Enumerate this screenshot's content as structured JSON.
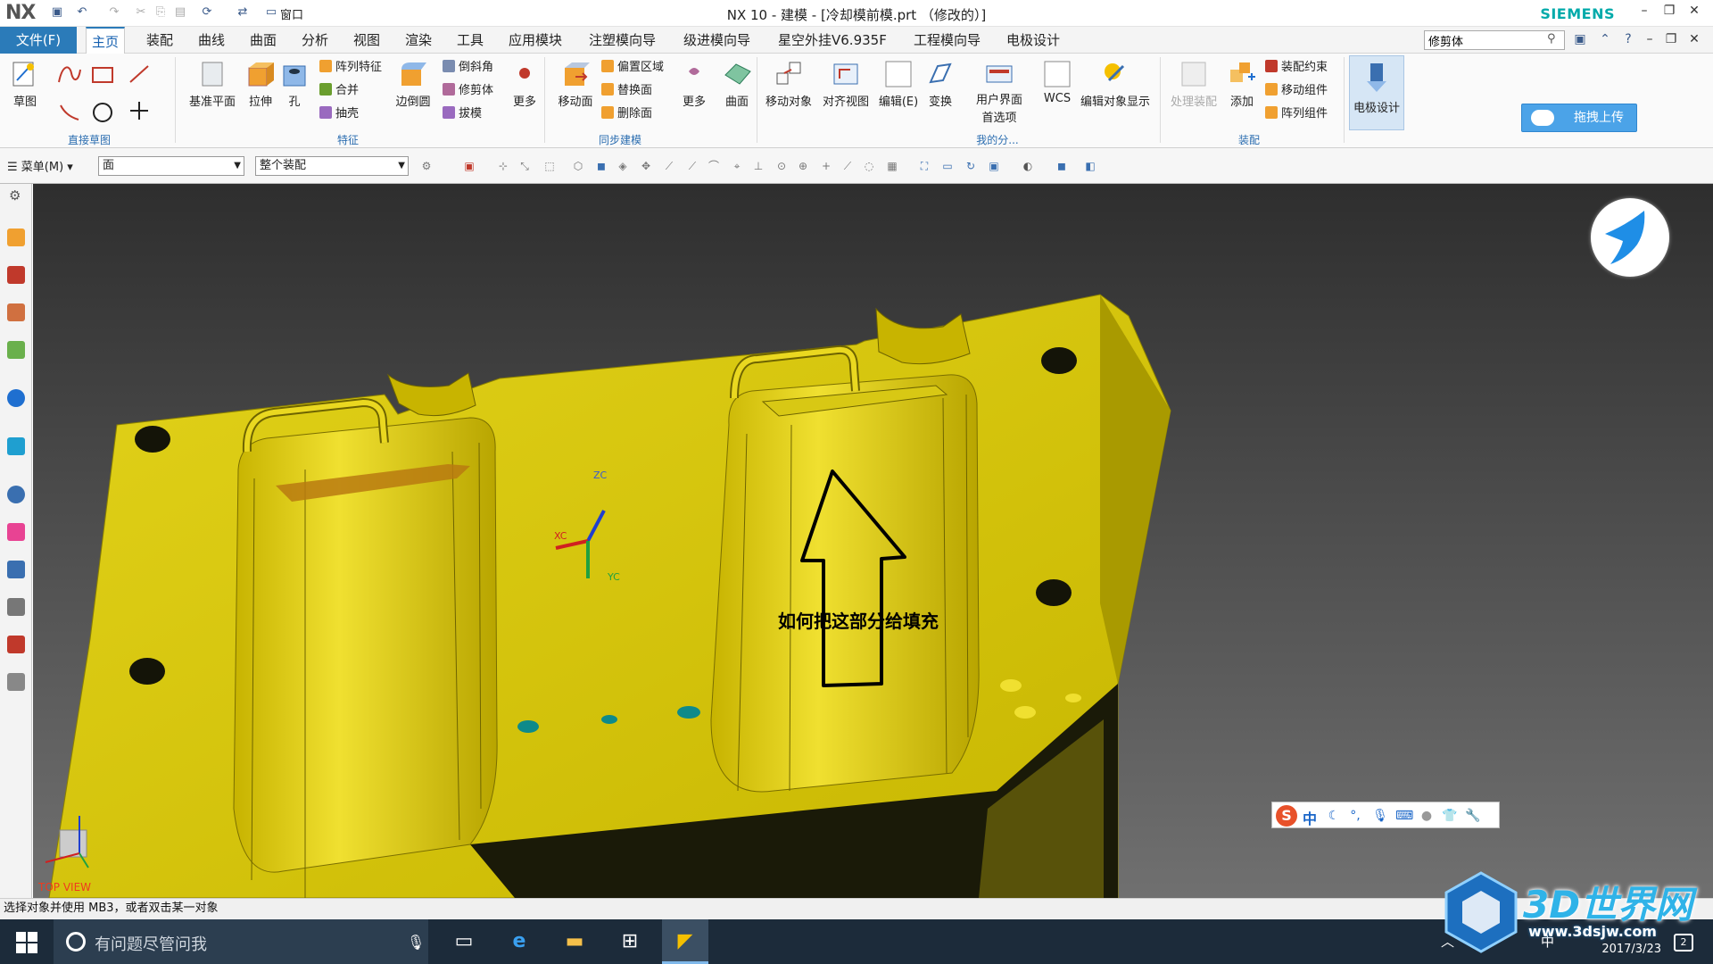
{
  "titlebar": {
    "logo": "NX",
    "window_menu": "窗口",
    "title": "NX 10 - 建模 - [冷却模前模.prt （修改的）]",
    "brand": "SIEMENS",
    "minimize": "–",
    "restore": "❐",
    "close": "✕"
  },
  "menubar": {
    "file": "文件(F)",
    "tabs": [
      "主页",
      "装配",
      "曲线",
      "曲面",
      "分析",
      "视图",
      "渲染",
      "工具",
      "应用模块",
      "注塑模向导",
      "级进模向导",
      "星空外挂V6.935F",
      "工程模向导",
      "电极设计"
    ],
    "active_tab": "主页",
    "command_search": "修剪体"
  },
  "ribbon": {
    "sketch": "草图",
    "group_direct_sketch": "直接草图",
    "datum_plane": "基准平面",
    "extrude": "拉伸",
    "hole": "孔",
    "pattern_feature": "阵列特征",
    "unite": "合并",
    "shell": "抽壳",
    "edge_blend": "边倒圆",
    "chamfer": "倒斜角",
    "trim_body": "修剪体",
    "draft": "拔模",
    "more1": "更多",
    "group_feature": "特征",
    "move_face": "移动面",
    "offset_region": "偏置区域",
    "replace_face": "替换面",
    "delete_face": "删除面",
    "more2": "更多",
    "surface": "曲面",
    "group_sync": "同步建模",
    "move_object": "移动对象",
    "align_view": "对齐视图",
    "edit": "编辑(E)",
    "transform": "变换",
    "ui_pref_line1": "用户界面",
    "ui_pref_line2": "首选项",
    "group_mine": "我的分...",
    "wcs": "WCS",
    "edit_display": "编辑对象显示",
    "process_assembly": "处理装配",
    "add": "添加",
    "assembly_constraint": "装配约束",
    "move_component": "移动组件",
    "pattern_component": "阵列组件",
    "group_assembly": "装配",
    "electrode_design": "电极设计",
    "drag_upload": "拖拽上传"
  },
  "toolbar2": {
    "menu": "菜单(M)",
    "selection_filter": "面",
    "scope": "整个装配"
  },
  "viewport": {
    "annotation": "如何把这部分给填充",
    "view_name": "TOP VIEW",
    "axis_x": "XC",
    "axis_y": "YC",
    "axis_z": "ZC",
    "ime_lang": "中"
  },
  "status": {
    "message": "选择对象并使用 MB3，或者双击某一对象"
  },
  "taskbar": {
    "search_placeholder": "有问题尽管问我",
    "ime": "中",
    "date": "2017/3/23",
    "notifications": "2"
  },
  "watermark": {
    "brand": "3D世界网",
    "url": "www.3dsjw.com"
  },
  "colors": {
    "mold": "#d4c400",
    "accent": "#2b7bb9",
    "annotation": "#000000",
    "taskbar": "#1c2b3a"
  }
}
